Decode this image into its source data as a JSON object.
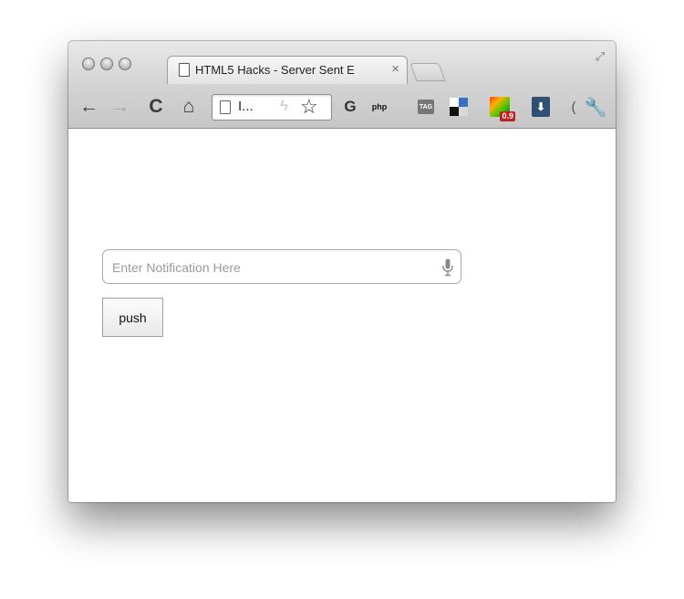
{
  "browser": {
    "tab": {
      "title": "HTML5 Hacks - Server Sent E",
      "close_symbol": "×"
    },
    "toolbar": {
      "back_symbol": "←",
      "forward_symbol": "→",
      "reload_symbol": "C",
      "home_symbol": "⌂",
      "omnibox_text": "I...",
      "extensions": [
        {
          "name": "g-icon",
          "glyph": "G"
        },
        {
          "name": "php-icon",
          "glyph": "php"
        },
        {
          "name": "tag-icon",
          "glyph": "TAG"
        },
        {
          "name": "delicious-icon",
          "glyph": ""
        },
        {
          "name": "color-picker-icon",
          "badge": "0.9"
        },
        {
          "name": "mic-extension-icon",
          "glyph": "⬇"
        },
        {
          "name": "overflow-chevron-icon",
          "glyph": "("
        },
        {
          "name": "wrench-icon",
          "glyph": "🔧"
        }
      ]
    }
  },
  "page": {
    "notification_input": {
      "placeholder": "Enter Notification Here",
      "value": ""
    },
    "push_button_label": "push"
  }
}
